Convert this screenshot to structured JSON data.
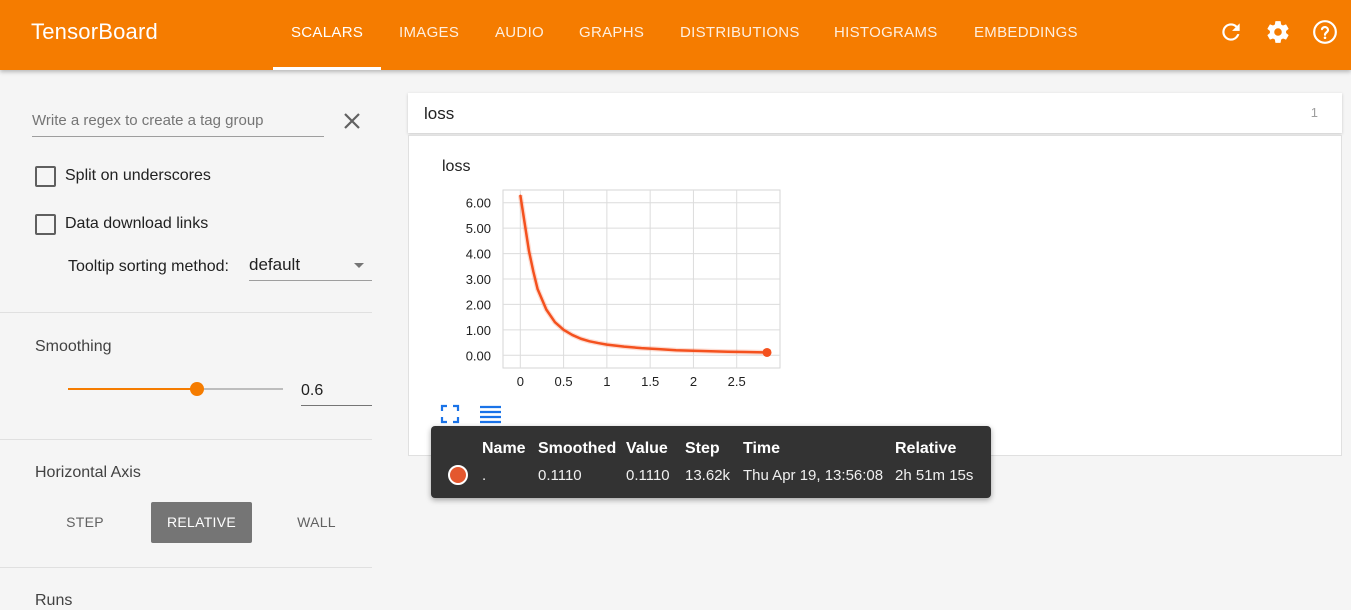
{
  "app": {
    "title": "TensorBoard"
  },
  "nav": {
    "tabs": [
      {
        "label": "SCALARS",
        "active": true
      },
      {
        "label": "IMAGES"
      },
      {
        "label": "AUDIO"
      },
      {
        "label": "GRAPHS"
      },
      {
        "label": "DISTRIBUTIONS"
      },
      {
        "label": "HISTOGRAMS"
      },
      {
        "label": "EMBEDDINGS"
      }
    ],
    "icons": [
      "refresh-icon",
      "settings-gear-icon",
      "help-icon"
    ]
  },
  "sidebar": {
    "regex_placeholder": "Write a regex to create a tag group",
    "split_label": "Split on underscores",
    "download_label": "Data download links",
    "sort_label": "Tooltip sorting method:",
    "sort_value": "default",
    "smoothing_title": "Smoothing",
    "smoothing_value": "0.6",
    "smoothing_fraction": 0.6,
    "axis_title": "Horizontal Axis",
    "axis_options": [
      "STEP",
      "RELATIVE",
      "WALL"
    ],
    "axis_selected": "RELATIVE",
    "runs_title": "Runs"
  },
  "card": {
    "title": "loss",
    "count": "1",
    "chart_title": "loss"
  },
  "chart_data": {
    "type": "line",
    "title": "loss",
    "x_ticks": [
      "0",
      "0.5",
      "1",
      "1.5",
      "2",
      "2.5"
    ],
    "y_ticks": [
      "0.00",
      "1.00",
      "2.00",
      "3.00",
      "4.00",
      "5.00",
      "6.00"
    ],
    "xlim": [
      -0.2,
      3.0
    ],
    "ylim": [
      -0.5,
      6.5
    ],
    "series": [
      {
        "color": "#f4511e",
        "x": [
          0,
          0.05,
          0.1,
          0.15,
          0.2,
          0.3,
          0.4,
          0.5,
          0.6,
          0.7,
          0.8,
          0.9,
          1.0,
          1.2,
          1.4,
          1.6,
          1.8,
          2.0,
          2.2,
          2.4,
          2.6,
          2.85
        ],
        "y": [
          6.3,
          5.2,
          4.1,
          3.3,
          2.6,
          1.8,
          1.3,
          1.0,
          0.8,
          0.65,
          0.55,
          0.48,
          0.42,
          0.34,
          0.28,
          0.24,
          0.2,
          0.18,
          0.16,
          0.14,
          0.13,
          0.111
        ]
      }
    ]
  },
  "tooltip": {
    "headers": [
      "Name",
      "Smoothed",
      "Value",
      "Step",
      "Time",
      "Relative"
    ],
    "row": {
      "dot_color": "#e4572e",
      "name": ".",
      "smoothed": "0.1110",
      "value": "0.1110",
      "step": "13.62k",
      "time": "Thu Apr 19, 13:56:08",
      "relative": "2h 51m 15s"
    }
  }
}
